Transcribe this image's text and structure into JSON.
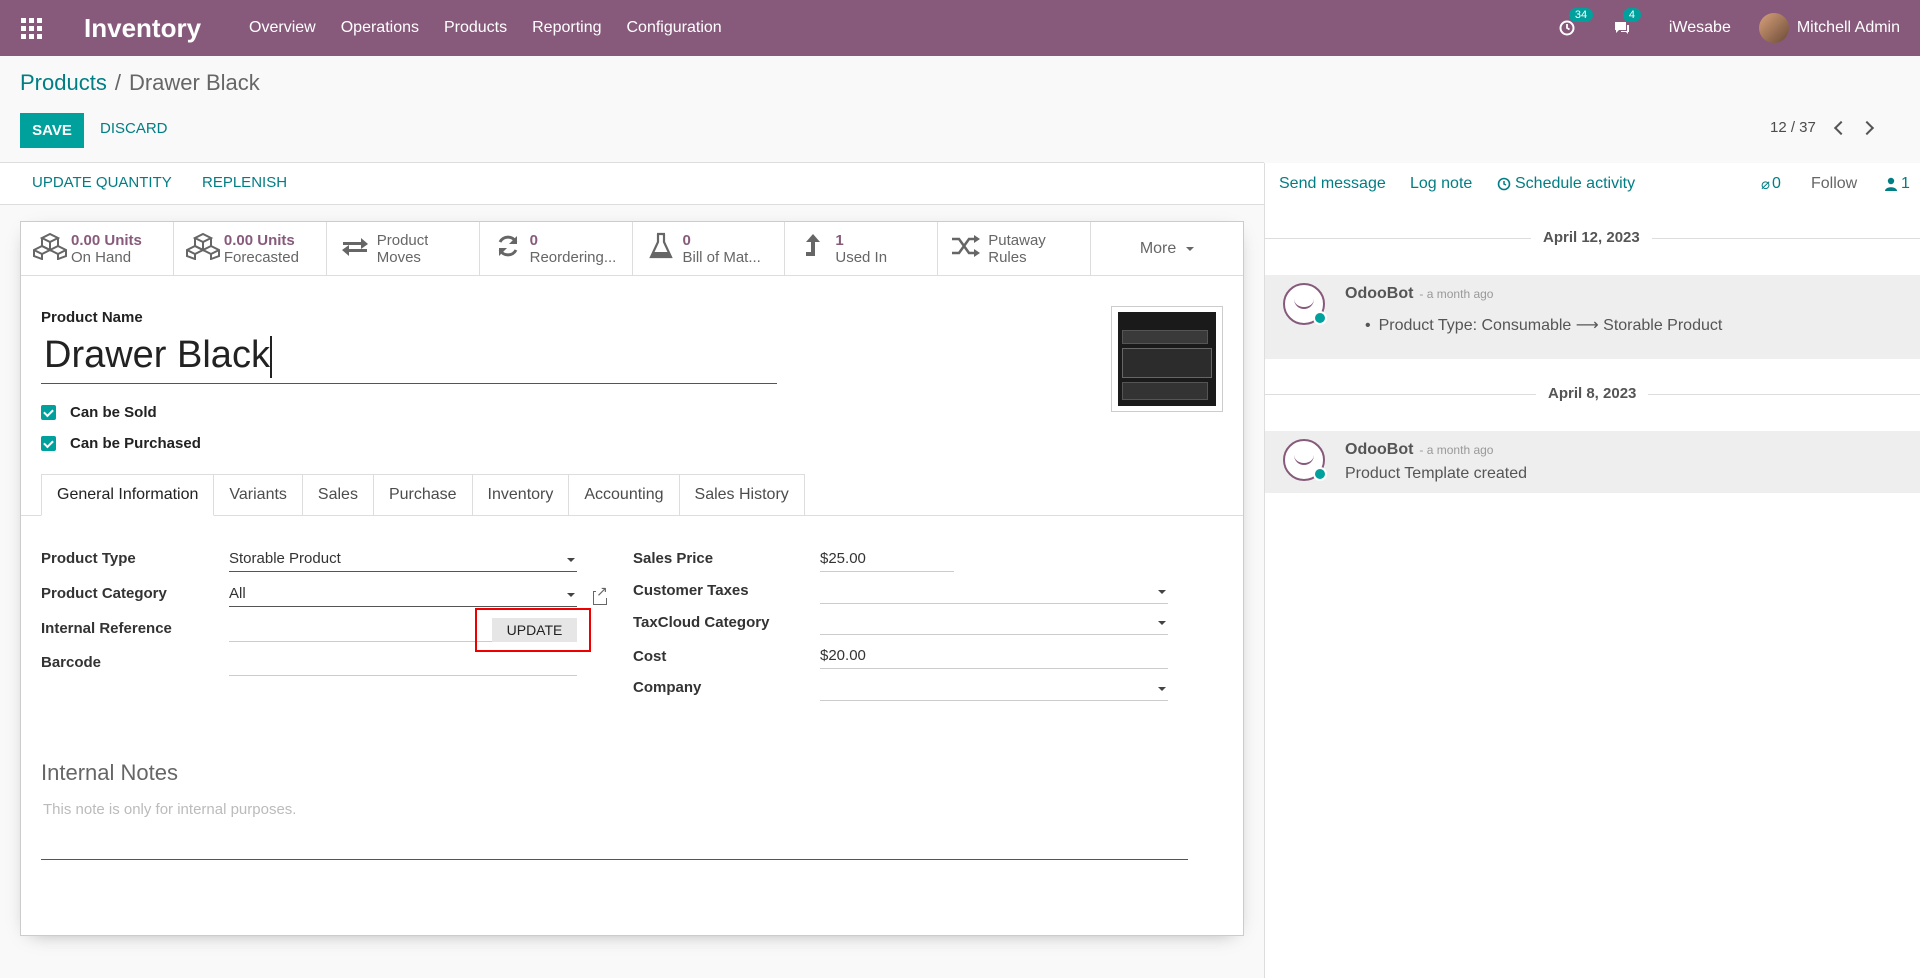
{
  "navbar": {
    "brand": "Inventory",
    "menu": [
      "Overview",
      "Operations",
      "Products",
      "Reporting",
      "Configuration"
    ],
    "activities_count": "34",
    "messages_count": "4",
    "company": "iWesabe",
    "user": "Mitchell Admin"
  },
  "breadcrumb": {
    "parent": "Products",
    "separator": "/",
    "current": "Drawer Black"
  },
  "actions": {
    "save": "SAVE",
    "discard": "DISCARD"
  },
  "pager": {
    "value": "12 / 37"
  },
  "statusbar": {
    "update_quantity": "UPDATE QUANTITY",
    "replenish": "REPLENISH"
  },
  "smart_buttons": [
    {
      "icon": "cubes-icon",
      "value": "0.00 Units",
      "label": "On Hand"
    },
    {
      "icon": "cubes-icon",
      "value": "0.00 Units",
      "label": "Forecasted"
    },
    {
      "icon": "exchange-icon",
      "value": "Product",
      "label": "Moves"
    },
    {
      "icon": "refresh-icon",
      "value": "0",
      "label": "Reordering..."
    },
    {
      "icon": "flask-icon",
      "value": "0",
      "label": "Bill of Mat..."
    },
    {
      "icon": "level-up-icon",
      "value": "1",
      "label": "Used In"
    },
    {
      "icon": "random-icon",
      "value": "Putaway",
      "label": "Rules"
    }
  ],
  "more_label": "More",
  "form": {
    "product_name_label": "Product Name",
    "product_name": "Drawer Black",
    "can_be_sold": "Can be Sold",
    "can_be_purchased": "Can be Purchased"
  },
  "tabs": [
    "General Information",
    "Variants",
    "Sales",
    "Purchase",
    "Inventory",
    "Accounting",
    "Sales History"
  ],
  "general": {
    "product_type_label": "Product Type",
    "product_type": "Storable Product",
    "product_category_label": "Product Category",
    "product_category": "All",
    "internal_reference_label": "Internal Reference",
    "internal_reference": "",
    "update_label": "UPDATE",
    "barcode_label": "Barcode",
    "barcode": "",
    "sales_price_label": "Sales Price",
    "currency": "$",
    "sales_price": "25.00",
    "customer_taxes_label": "Customer Taxes",
    "taxcloud_category_label": "TaxCloud Category",
    "cost_label": "Cost",
    "cost": "20.00",
    "company_label": "Company"
  },
  "notes": {
    "title": "Internal Notes",
    "placeholder": "This note is only for internal purposes."
  },
  "chatter": {
    "send_message": "Send message",
    "log_note": "Log note",
    "schedule_activity": "Schedule activity",
    "attachments": "0",
    "follow": "Follow",
    "followers": "1",
    "groups": [
      {
        "date": "April 12, 2023",
        "author": "OdooBot",
        "time": "- a month ago",
        "body": "Product Type: Consumable ⟶ Storable Product"
      },
      {
        "date": "April 8, 2023",
        "author": "OdooBot",
        "time": "- a month ago",
        "body": "Product Template created"
      }
    ]
  },
  "colors": {
    "brand": "#875a7b",
    "accent": "#00a09d",
    "link": "#017e84",
    "highlight": "#e00000"
  }
}
